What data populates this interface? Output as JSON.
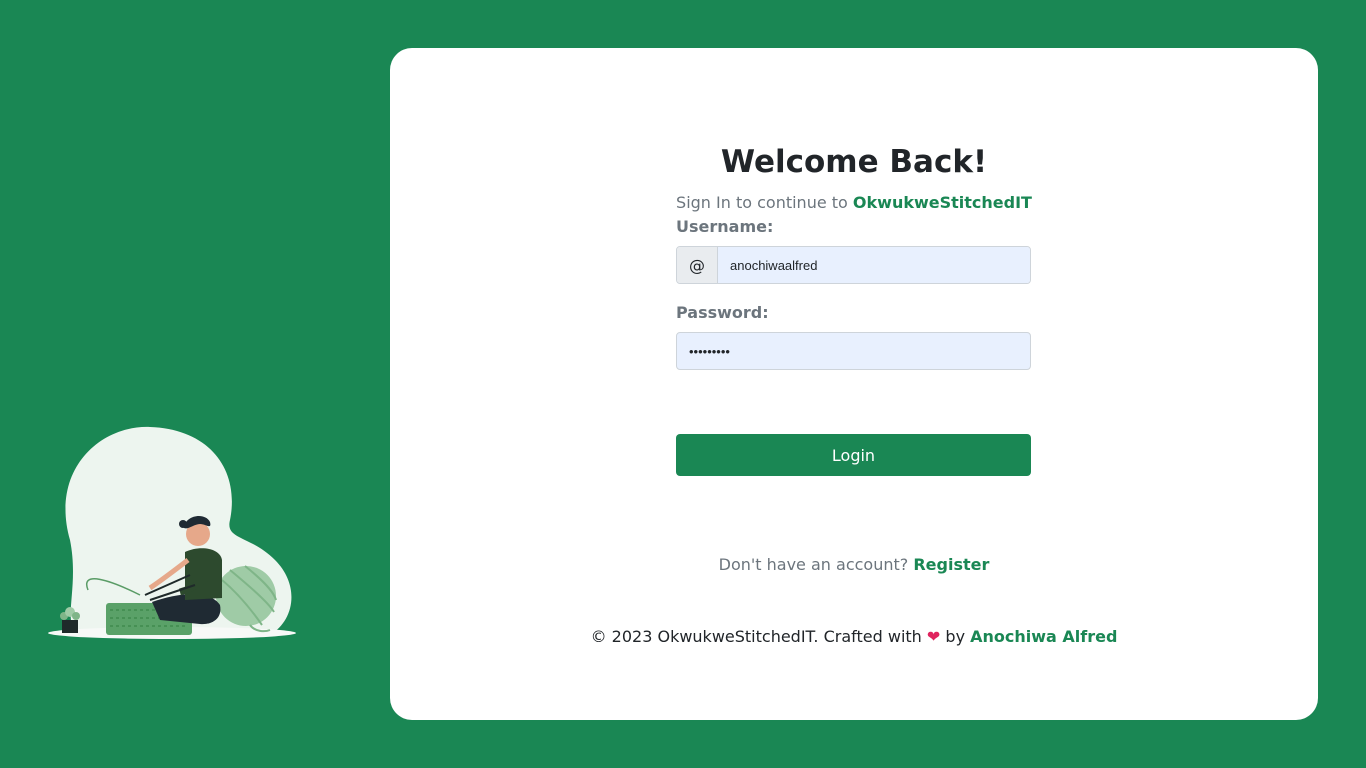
{
  "page": {
    "accent": "#1a8754",
    "background": "#1a8754"
  },
  "header": {
    "title": "Welcome Back!",
    "subtitle_prefix": "Sign In to continue to",
    "brand": "OkwukweStitchedIT"
  },
  "form": {
    "username_label": "Username:",
    "username_addon": "@",
    "username_value": "anochiwaalfred",
    "password_label": "Password:",
    "password_value": "•••••••••",
    "login_label": "Login"
  },
  "register": {
    "prompt": "Don't have an account?",
    "link": "Register"
  },
  "footer": {
    "copyright": "© 2023 OkwukweStitchedIT. Crafted with",
    "heart": "❤",
    "by": "by",
    "author": "Anochiwa Alfred"
  },
  "illustration": {
    "icon": "woman-knitting-illustration"
  }
}
